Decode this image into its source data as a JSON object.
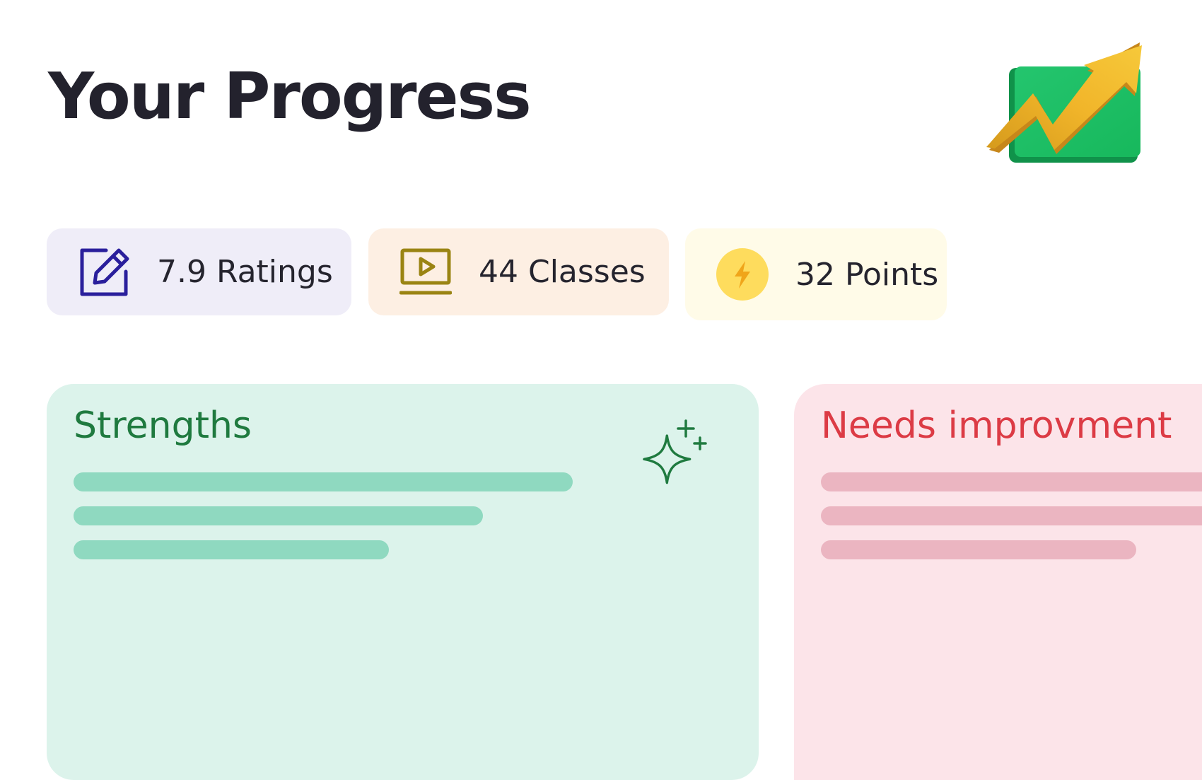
{
  "header": {
    "title": "Your Progress",
    "hero_icon": "growth-chart-arrow-icon"
  },
  "stats": [
    {
      "icon": "edit-icon",
      "label": "7.9 Ratings",
      "color": "#2a1f9c"
    },
    {
      "icon": "video-lesson-icon",
      "label": "44 Classes",
      "color": "#9a8413"
    },
    {
      "icon": "lightning-icon",
      "label": "32 Points",
      "color": "#f0b41a"
    }
  ],
  "panels": {
    "strengths": {
      "title": "Strengths",
      "icon": "sparkle-icon",
      "accent": "#1f7a3f"
    },
    "needs_improvement": {
      "title": "Needs improvment",
      "accent": "#dc3b45"
    }
  },
  "colors": {
    "background": "#ffffff",
    "ratings_chip": "#efedf8",
    "classes_chip": "#fdefe3",
    "points_chip": "#fffbe8",
    "strengths_panel": "#dcf3eb",
    "needs_panel": "#fce4e9"
  }
}
